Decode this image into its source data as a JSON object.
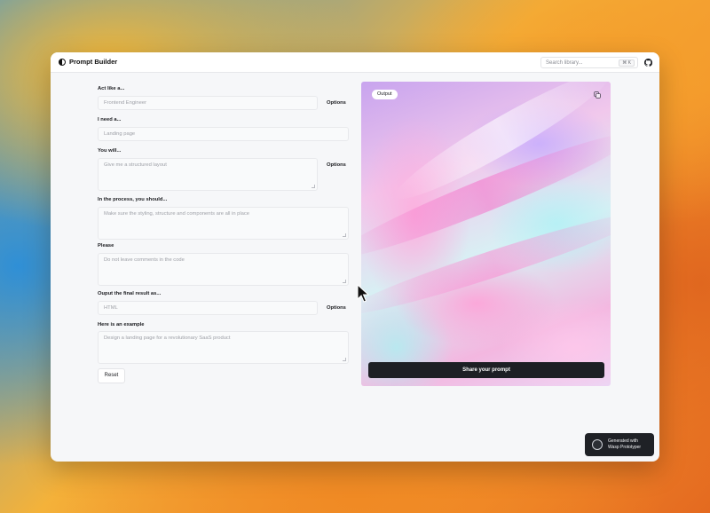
{
  "app": {
    "title": "Prompt Builder"
  },
  "search": {
    "placeholder": "Search library...",
    "shortcut": "⌘ K"
  },
  "form": {
    "act_like": {
      "label": "Act like a...",
      "placeholder": "Frontend Engineer",
      "options_label": "Options"
    },
    "i_need": {
      "label": "I need a...",
      "placeholder": "Landing page"
    },
    "you_will": {
      "label": "You will...",
      "placeholder": "Give me a structured layout",
      "options_label": "Options"
    },
    "in_process": {
      "label": "In the process, you should...",
      "placeholder": "Make sure the styling, structure and components are all in place"
    },
    "please": {
      "label": "Please",
      "placeholder": "Do not leave comments in the code"
    },
    "output_as": {
      "label": "Ouput the final result as...",
      "placeholder": "HTML",
      "options_label": "Options"
    },
    "example": {
      "label": "Here is an example",
      "placeholder": "Design a landing page for a revolutionary SaaS product"
    },
    "reset_label": "Reset"
  },
  "output": {
    "badge": "Output",
    "share_label": "Share your prompt"
  },
  "wasp": {
    "line1": "Generated with",
    "line2": "Wasp Prototyper"
  }
}
